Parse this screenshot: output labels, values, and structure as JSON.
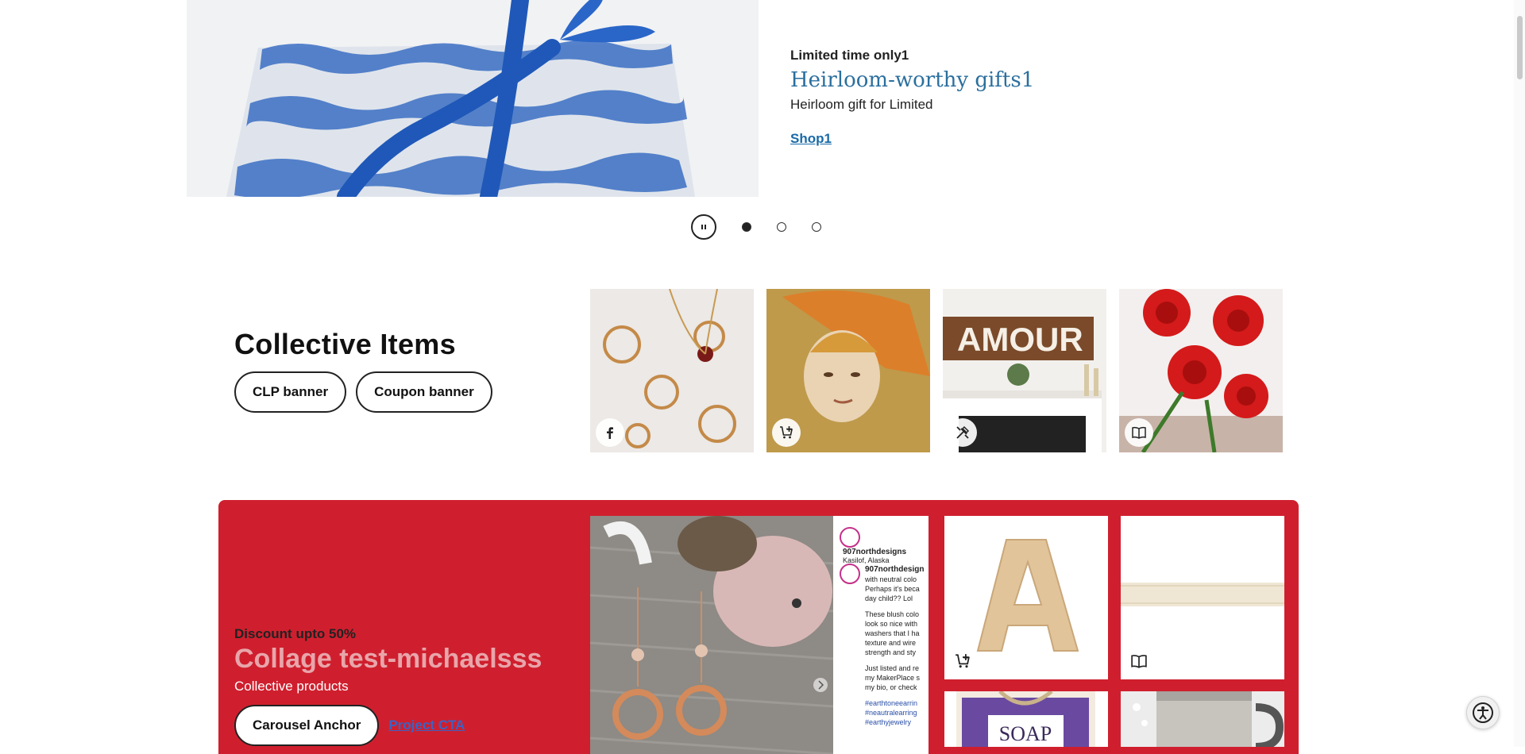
{
  "hero": {
    "eyebrow": "Limited time only1",
    "title": "Heirloom-worthy gifts1",
    "description": "Heirloom gift for Limited",
    "link_label": "Shop1",
    "slide_count": 3,
    "active_slide": 1
  },
  "collective": {
    "title": "Collective Items",
    "pills": [
      "CLP banner",
      "Coupon banner"
    ],
    "tiles": [
      {
        "icon": "facebook-icon"
      },
      {
        "icon": "cart-plus-icon"
      },
      {
        "icon": "tools-icon",
        "sign_text": "AMOUR"
      },
      {
        "icon": "book-icon"
      }
    ]
  },
  "collage": {
    "eyebrow": "Discount upto 50%",
    "title": "Collage test-michaelsss",
    "description": "Collective products",
    "anchor_label": "Carousel Anchor",
    "cta_label": "Project CTA",
    "instagram": {
      "handle": "907northdesigns",
      "location": "Kasilof, Alaska",
      "caption_lines": [
        "907northdesign",
        "with neutral colo",
        "Perhaps it's beca",
        "day child?? Lol",
        "These blush colo",
        "look so nice with",
        "washers that I ha",
        "texture and wire",
        "strength and sty",
        "Just listed and re",
        "my MakerPlace s",
        "my bio, or check"
      ],
      "hashtags": [
        "#earthtoneearrin",
        "#neautralearring",
        "#earthyjewelry"
      ]
    },
    "products": [
      {
        "icon": "cart-plus-icon",
        "letter": "A"
      },
      {
        "icon": "book-icon"
      },
      {
        "label": "SOAP"
      },
      {}
    ]
  },
  "colors": {
    "collage_red": "#cf1f2e",
    "hero_title": "#2b6f9e",
    "link_blue": "#1a6aa8"
  }
}
